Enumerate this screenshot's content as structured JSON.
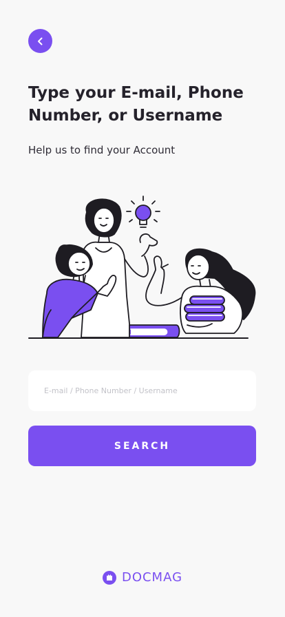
{
  "header": {
    "back_icon": "chevron-left-icon",
    "title": "Type your E-mail, Phone Number, or Username",
    "subtitle": "Help us to find your Account"
  },
  "form": {
    "placeholder": "E-mail / Phone Number / Username",
    "value": "",
    "button_label": "SEARCH"
  },
  "footer": {
    "brand_name": "DOCMAG",
    "brand_icon": "docmag-logo-icon"
  },
  "colors": {
    "accent": "#7a4ff0",
    "background": "#f8f8f8",
    "text": "#25222b",
    "placeholder": "#c2c2c8"
  }
}
